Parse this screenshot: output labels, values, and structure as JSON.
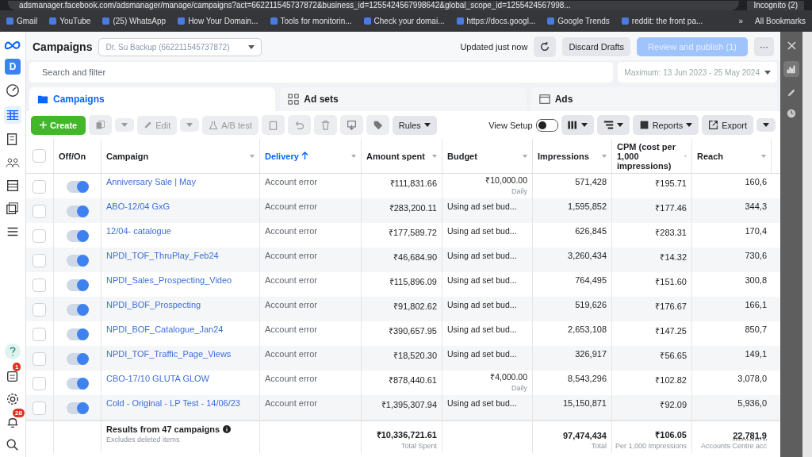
{
  "browser": {
    "url": "adsmanager.facebook.com/adsmanager/manage/campaigns?act=662211545737872&business_id=1255424567998642&global_scope_id=1255424567998...",
    "profile": "Incognito (2)",
    "bookmarks": [
      "Gmail",
      "YouTube",
      "(25) WhatsApp",
      "How Your Domain...",
      "Tools for monitorin...",
      "Check your domai...",
      "https://docs.googl...",
      "Google Trends",
      "reddit: the front pa..."
    ],
    "all_bookmarks": "All Bookmarks",
    "more": "»"
  },
  "nav": {
    "avatar": "D",
    "badges": [
      "1",
      "28"
    ]
  },
  "header": {
    "title": "Campaigns",
    "account": "Dr. Su Backup (662211545737872)",
    "updated": "Updated just now",
    "discard": "Discard Drafts",
    "publish": "Review and publish (1)",
    "more": "···"
  },
  "search": {
    "placeholder": "Search and filter",
    "date_range": "Maximum: 13 Jun 2023 - 25 May 2024"
  },
  "tabs": [
    {
      "label": "Campaigns",
      "selected": true
    },
    {
      "label": "Ad sets",
      "selected": false
    },
    {
      "label": "Ads",
      "selected": false
    }
  ],
  "toolbar": {
    "create": "Create",
    "edit": "Edit",
    "ab_test": "A/B test",
    "rules": "Rules",
    "view_setup": "View Setup",
    "view_setup_on": false,
    "reports": "Reports",
    "export": "Export"
  },
  "table": {
    "select_all_checked": false,
    "columns": [
      {
        "label": "Off/On",
        "sorted": false
      },
      {
        "label": "Campaign",
        "sorted": false
      },
      {
        "label": "Delivery",
        "sorted": true
      },
      {
        "label": "Amount spent",
        "sorted": false
      },
      {
        "label": "Budget",
        "sorted": false
      },
      {
        "label": "Impressions",
        "sorted": false
      },
      {
        "label": "CPM (cost per 1,000 impressions)",
        "sorted": false
      },
      {
        "label": "Reach",
        "sorted": false
      }
    ],
    "rows": [
      {
        "checked": false,
        "on": true,
        "campaign": "Anniversary Sale | May",
        "delivery": "Account error",
        "spent": "₹111,831.66",
        "budget": "₹10,000.00",
        "budget_note": "Daily",
        "impressions": "571,428",
        "cpm": "₹195.71",
        "reach": "160,6"
      },
      {
        "checked": false,
        "on": true,
        "campaign": "ABO-12/04 GxG",
        "delivery": "Account error",
        "spent": "₹283,200.11",
        "budget": "Using ad set bud...",
        "impressions": "1,595,852",
        "cpm": "₹177.46",
        "reach": "344,3"
      },
      {
        "checked": false,
        "on": true,
        "campaign": "12/04- catalogue",
        "delivery": "Account error",
        "spent": "₹177,589.72",
        "budget": "Using ad set bud...",
        "impressions": "626,845",
        "cpm": "₹283.31",
        "reach": "170,4"
      },
      {
        "checked": false,
        "on": true,
        "campaign": "NPDI_TOF_ThruPlay_Feb24",
        "delivery": "Account error",
        "spent": "₹46,684.90",
        "budget": "Using ad set bud...",
        "impressions": "3,260,434",
        "cpm": "₹14.32",
        "reach": "730,6"
      },
      {
        "checked": false,
        "on": true,
        "campaign": "NPDI_Sales_Prospecting_Video",
        "delivery": "Account error",
        "spent": "₹115,896.09",
        "budget": "Using ad set bud...",
        "impressions": "764,495",
        "cpm": "₹151.60",
        "reach": "300,8"
      },
      {
        "checked": false,
        "on": true,
        "campaign": "NPDI_BOF_Prospecting",
        "delivery": "Account error",
        "spent": "₹91,802.62",
        "budget": "Using ad set bud...",
        "impressions": "519,626",
        "cpm": "₹176.67",
        "reach": "166,1"
      },
      {
        "checked": false,
        "on": true,
        "campaign": "NPDI_BOF_Catalogue_Jan24",
        "delivery": "Account error",
        "spent": "₹390,657.95",
        "budget": "Using ad set bud...",
        "impressions": "2,653,108",
        "cpm": "₹147.25",
        "reach": "850,7"
      },
      {
        "checked": false,
        "on": true,
        "campaign": "NPDI_TOF_Traffic_Page_Views",
        "delivery": "Account error",
        "spent": "₹18,520.30",
        "budget": "Using ad set bud...",
        "impressions": "326,917",
        "cpm": "₹56.65",
        "reach": "149,1"
      },
      {
        "checked": false,
        "on": true,
        "campaign": "CBO-17/10 GLUTA GLOW",
        "delivery": "Account error",
        "spent": "₹878,440.61",
        "budget": "₹4,000.00",
        "budget_note": "Daily",
        "impressions": "8,543,296",
        "cpm": "₹102.82",
        "reach": "3,078,0"
      },
      {
        "checked": false,
        "on": true,
        "campaign": "Cold - Original - LP Test - 14/06/23",
        "delivery": "Account error",
        "spent": "₹1,395,307.94",
        "budget": "Using ad set bud...",
        "impressions": "15,150,871",
        "cpm": "₹92.09",
        "reach": "5,936,0"
      }
    ],
    "footer": {
      "results": "Results from 47 campaigns",
      "results_note": "Excludes deleted items",
      "spent": "₹10,336,721.61",
      "spent_note": "Total Spent",
      "impressions": "97,474,434",
      "impressions_note": "Total",
      "cpm": "₹106.05",
      "cpm_note": "Per 1,000 Impressions",
      "reach": "22,781,9",
      "reach_note": "Accounts Centre acc"
    }
  }
}
